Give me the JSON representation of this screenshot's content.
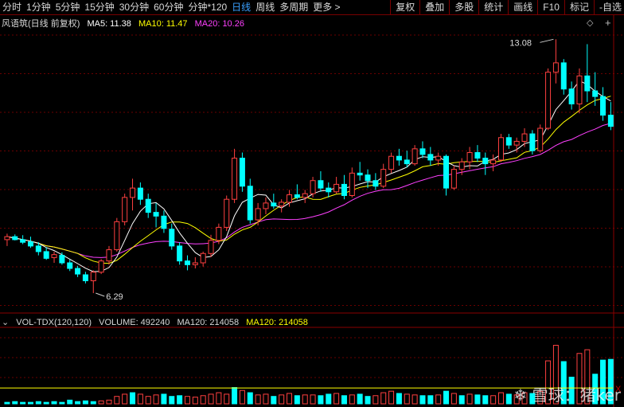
{
  "toolbar": {
    "left_items": [
      "分时",
      "1分钟",
      "5分钟",
      "15分钟",
      "30分钟",
      "60分钟",
      "分钟*120",
      "日线",
      "周线",
      "多周期",
      "更多 >"
    ],
    "active_index": 7,
    "right_items": [
      "复权",
      "叠加",
      "多股",
      "统计",
      "画线",
      "F10",
      "标记",
      "-自选"
    ]
  },
  "legend": {
    "title": "风语筑(日线 前复权)",
    "ma5": "MA5: 11.38",
    "ma10": "MA10: 11.47",
    "ma20": "MA20: 10.26"
  },
  "volume_legend": {
    "title": "VOL-TDX(120,120)",
    "volume": "VOLUME: 492240",
    "ma120_a": "MA120: 214058",
    "ma120_b": "MA120: 214058"
  },
  "controls": {
    "diamond_icon": "◇",
    "plus_icon": "+",
    "close_icon": "X"
  },
  "watermark": "❄ 雪球：猪ker",
  "colors": {
    "up": "#ff4040",
    "down": "#00ffff",
    "ma5": "#ffffff",
    "ma10": "#ffff00",
    "ma20": "#ff40ff",
    "grid": "#6a0000",
    "active_tab": "#3aa0ff"
  },
  "chart_data": {
    "type": "candlestick",
    "price_ylim": [
      5.8,
      13.3
    ],
    "volume_ylim": [
      0,
      1000000
    ],
    "annotations": {
      "max_label": "13.08",
      "min_label": "6.29"
    },
    "candles": [
      [
        7.72,
        7.88,
        7.55,
        7.8
      ],
      [
        7.8,
        7.86,
        7.7,
        7.72
      ],
      [
        7.72,
        7.84,
        7.6,
        7.65
      ],
      [
        7.66,
        7.8,
        7.5,
        7.55
      ],
      [
        7.55,
        7.65,
        7.3,
        7.4
      ],
      [
        7.4,
        7.52,
        7.18,
        7.22
      ],
      [
        7.24,
        7.4,
        7.1,
        7.32
      ],
      [
        7.3,
        7.38,
        7.05,
        7.1
      ],
      [
        7.1,
        7.18,
        6.88,
        6.95
      ],
      [
        6.95,
        7.02,
        6.72,
        6.8
      ],
      [
        6.78,
        6.86,
        6.55,
        6.62
      ],
      [
        6.62,
        6.9,
        6.29,
        6.85
      ],
      [
        6.85,
        7.2,
        6.8,
        7.15
      ],
      [
        7.15,
        7.55,
        7.05,
        7.45
      ],
      [
        7.45,
        8.3,
        7.4,
        8.2
      ],
      [
        8.2,
        8.95,
        8.1,
        8.85
      ],
      [
        8.85,
        9.35,
        8.5,
        9.1
      ],
      [
        9.1,
        9.25,
        8.65,
        8.8
      ],
      [
        8.8,
        8.95,
        8.3,
        8.45
      ],
      [
        8.45,
        8.7,
        8.05,
        8.35
      ],
      [
        8.35,
        8.5,
        7.9,
        8.02
      ],
      [
        8.0,
        8.15,
        7.45,
        7.55
      ],
      [
        7.55,
        7.65,
        7.05,
        7.15
      ],
      [
        7.15,
        7.3,
        6.9,
        7.05
      ],
      [
        7.05,
        7.25,
        6.95,
        7.1
      ],
      [
        7.1,
        7.4,
        7.0,
        7.35
      ],
      [
        7.35,
        7.85,
        7.25,
        7.7
      ],
      [
        7.7,
        8.15,
        7.6,
        8.05
      ],
      [
        8.05,
        8.9,
        7.95,
        8.8
      ],
      [
        8.8,
        10.15,
        8.7,
        9.9
      ],
      [
        9.9,
        10.05,
        9.0,
        9.15
      ],
      [
        9.15,
        9.35,
        8.15,
        8.25
      ],
      [
        8.25,
        8.7,
        8.1,
        8.55
      ],
      [
        8.55,
        8.85,
        8.4,
        8.7
      ],
      [
        8.7,
        8.95,
        8.55,
        8.62
      ],
      [
        8.62,
        8.8,
        8.45,
        8.72
      ],
      [
        8.72,
        9.05,
        8.6,
        8.92
      ],
      [
        8.92,
        9.2,
        8.8,
        8.85
      ],
      [
        8.85,
        9.05,
        8.7,
        8.95
      ],
      [
        8.95,
        9.4,
        8.85,
        9.3
      ],
      [
        9.3,
        9.55,
        9.0,
        9.1
      ],
      [
        9.1,
        9.25,
        8.85,
        9.0
      ],
      [
        9.0,
        9.4,
        8.95,
        9.2
      ],
      [
        9.2,
        9.45,
        8.8,
        8.9
      ],
      [
        8.9,
        9.65,
        8.85,
        9.5
      ],
      [
        9.5,
        9.8,
        9.3,
        9.45
      ],
      [
        9.45,
        9.6,
        9.1,
        9.3
      ],
      [
        9.3,
        9.5,
        9.05,
        9.15
      ],
      [
        9.15,
        9.75,
        9.1,
        9.6
      ],
      [
        9.6,
        10.05,
        9.5,
        9.95
      ],
      [
        9.95,
        10.15,
        9.7,
        9.85
      ],
      [
        9.85,
        10.1,
        9.65,
        9.75
      ],
      [
        9.75,
        10.25,
        9.7,
        10.15
      ],
      [
        10.15,
        10.35,
        9.9,
        10.0
      ],
      [
        10.0,
        10.2,
        9.7,
        9.85
      ],
      [
        9.85,
        10.05,
        9.7,
        9.95
      ],
      [
        9.95,
        10.0,
        8.9,
        9.1
      ],
      [
        9.1,
        9.7,
        9.05,
        9.6
      ],
      [
        9.6,
        9.9,
        9.45,
        9.8
      ],
      [
        9.8,
        10.2,
        9.6,
        10.05
      ],
      [
        10.05,
        10.25,
        9.8,
        9.9
      ],
      [
        9.9,
        10.05,
        9.45,
        9.75
      ],
      [
        9.75,
        10.0,
        9.55,
        9.85
      ],
      [
        9.85,
        10.55,
        9.8,
        10.45
      ],
      [
        10.45,
        10.55,
        10.15,
        10.25
      ],
      [
        10.25,
        10.45,
        10.05,
        10.35
      ],
      [
        10.35,
        10.7,
        10.2,
        10.55
      ],
      [
        10.55,
        10.65,
        10.0,
        10.1
      ],
      [
        10.1,
        10.8,
        10.05,
        10.7
      ],
      [
        10.7,
        12.3,
        10.65,
        12.2
      ],
      [
        12.2,
        13.08,
        11.9,
        12.45
      ],
      [
        12.45,
        12.55,
        11.6,
        11.75
      ],
      [
        11.75,
        11.95,
        11.2,
        11.35
      ],
      [
        11.35,
        12.3,
        11.1,
        12.1
      ],
      [
        12.1,
        12.95,
        11.4,
        11.7
      ],
      [
        11.7,
        12.2,
        11.3,
        11.55
      ],
      [
        11.55,
        11.8,
        10.9,
        11.05
      ],
      [
        11.05,
        11.4,
        10.65,
        10.75
      ]
    ],
    "volumes": [
      [
        2,
        0
      ],
      [
        3,
        0
      ],
      [
        2,
        0
      ],
      [
        2,
        0
      ],
      [
        3,
        0
      ],
      [
        2,
        0
      ],
      [
        3,
        0
      ],
      [
        2,
        0
      ],
      [
        5,
        0
      ],
      [
        3,
        0
      ],
      [
        4,
        0
      ],
      [
        3,
        0
      ],
      [
        4,
        1
      ],
      [
        5,
        1
      ],
      [
        10,
        1
      ],
      [
        13,
        1
      ],
      [
        15,
        0
      ],
      [
        13,
        1
      ],
      [
        10,
        1
      ],
      [
        12,
        1
      ],
      [
        13,
        0
      ],
      [
        10,
        0
      ],
      [
        11,
        0
      ],
      [
        10,
        1
      ],
      [
        9,
        1
      ],
      [
        11,
        1
      ],
      [
        13,
        1
      ],
      [
        15,
        1
      ],
      [
        13,
        1
      ],
      [
        22,
        0
      ],
      [
        18,
        1
      ],
      [
        15,
        0
      ],
      [
        12,
        1
      ],
      [
        13,
        1
      ],
      [
        10,
        0
      ],
      [
        12,
        1
      ],
      [
        14,
        1
      ],
      [
        11,
        0
      ],
      [
        12,
        1
      ],
      [
        12,
        1
      ],
      [
        11,
        0
      ],
      [
        13,
        0
      ],
      [
        14,
        1
      ],
      [
        11,
        0
      ],
      [
        12,
        1
      ],
      [
        13,
        0
      ],
      [
        10,
        0
      ],
      [
        11,
        1
      ],
      [
        15,
        1
      ],
      [
        17,
        1
      ],
      [
        14,
        0
      ],
      [
        13,
        1
      ],
      [
        12,
        1
      ],
      [
        11,
        0
      ],
      [
        11,
        0
      ],
      [
        12,
        1
      ],
      [
        17,
        0
      ],
      [
        14,
        1
      ],
      [
        11,
        0
      ],
      [
        13,
        1
      ],
      [
        12,
        0
      ],
      [
        11,
        0
      ],
      [
        11,
        1
      ],
      [
        15,
        1
      ],
      [
        13,
        0
      ],
      [
        12,
        1
      ],
      [
        15,
        1
      ],
      [
        14,
        0
      ],
      [
        17,
        1
      ],
      [
        58,
        1
      ],
      [
        79,
        1
      ],
      [
        57,
        0
      ],
      [
        36,
        0
      ],
      [
        68,
        1
      ],
      [
        73,
        1
      ],
      [
        40,
        0
      ],
      [
        59,
        0
      ],
      [
        60,
        0
      ]
    ],
    "ma": {
      "ma5": [],
      "ma10": [],
      "ma20": []
    }
  }
}
